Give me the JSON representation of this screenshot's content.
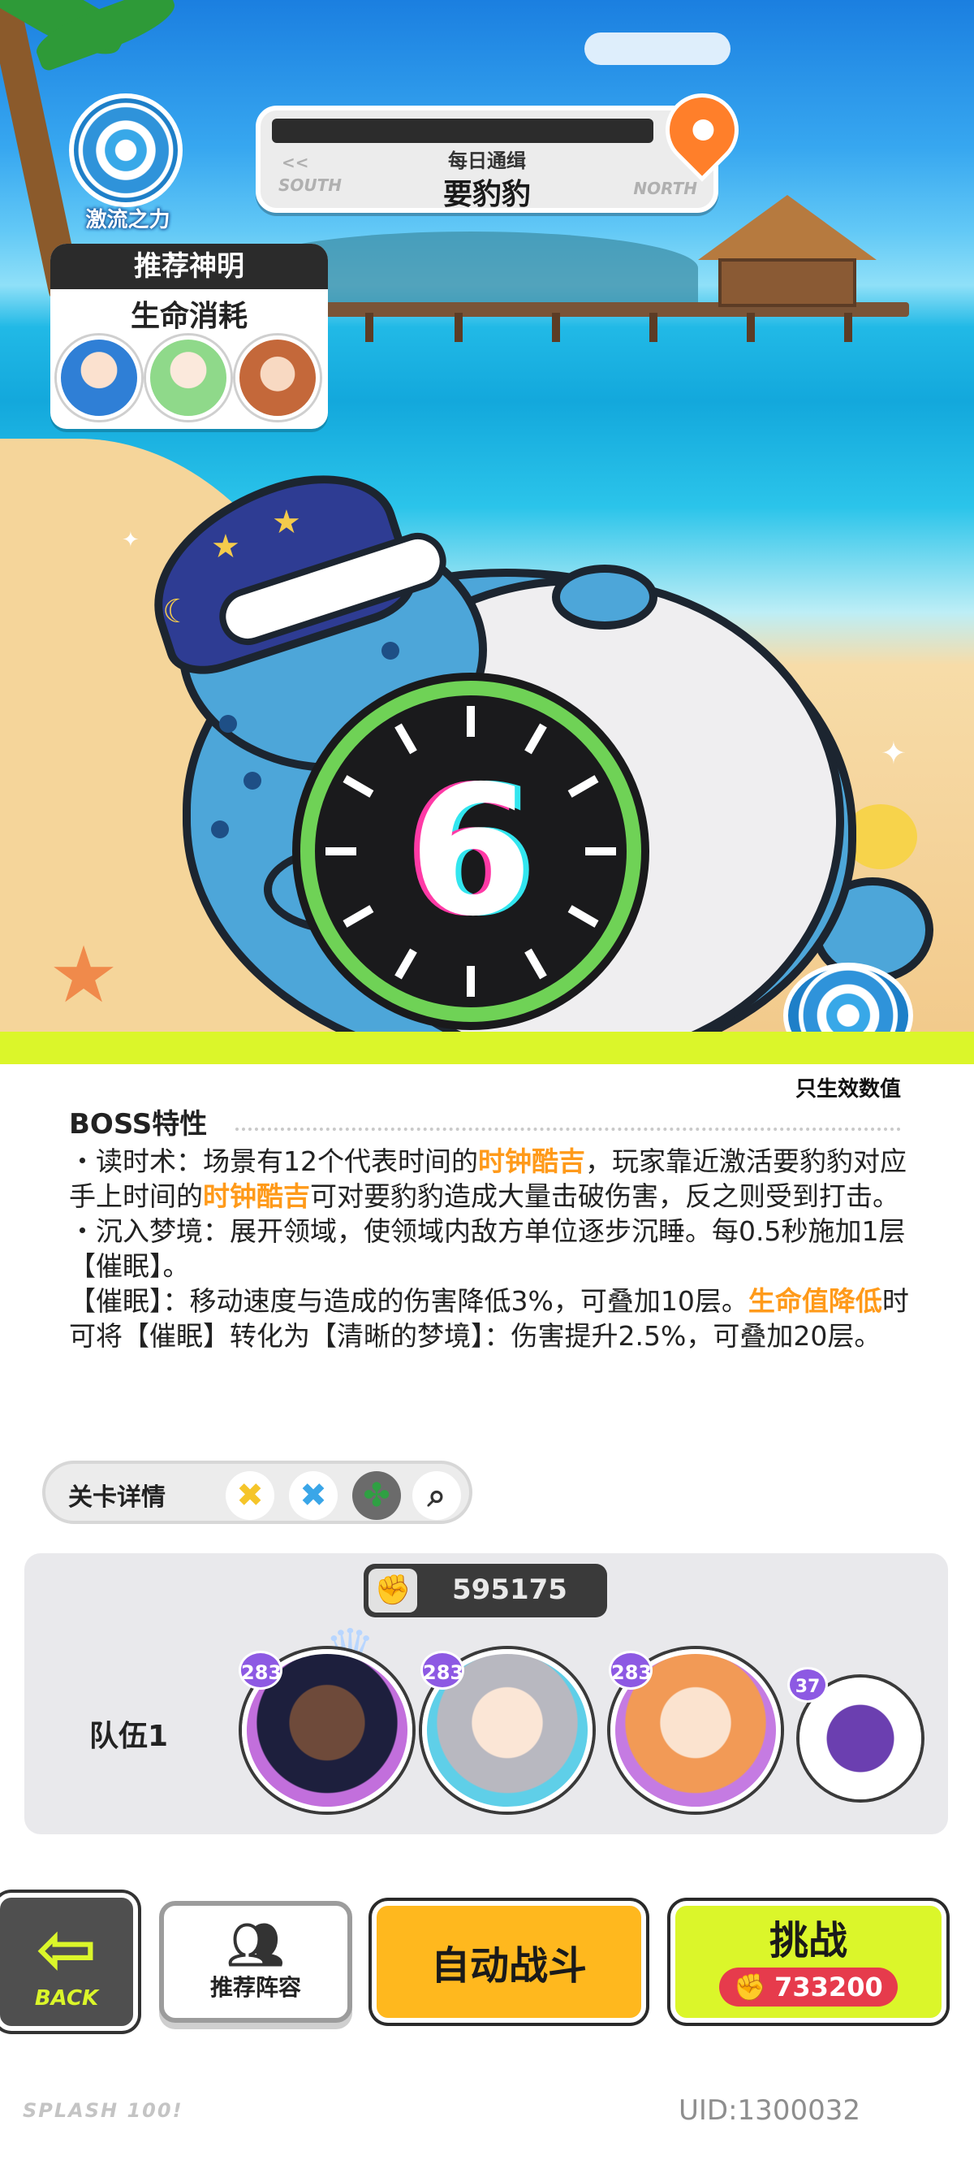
{
  "element": {
    "name": "激流之力",
    "icon": "water-swirl-icon",
    "note": "只生效数值"
  },
  "stage": {
    "subtitle": "每日通缉",
    "boss_name": "要豹豹",
    "left_direction": "SOUTH",
    "right_direction": "NORTH",
    "left_arrows": "<<"
  },
  "recommend": {
    "header": "推荐神明",
    "type": "生命消耗",
    "avatars": [
      "blue-hair-girl",
      "green-hair-girl",
      "brown-hair-boy"
    ]
  },
  "boss_clock": {
    "number": "6"
  },
  "boss_traits": {
    "title": "BOSS特性",
    "lines": [
      [
        "・读时术：场景有12个代表时间的",
        "时钟酷吉",
        "，玩家靠近激活要豹豹对应手上时间的",
        "时钟酷吉",
        "可对要豹豹造成大量击破伤害，反之则受到打击。"
      ],
      [
        "・沉入梦境：展开领域，使领域内敌方单位逐步沉睡。每0.5秒施加1层【催眠】。"
      ],
      [
        "【催眠】：移动速度与造成的伤害降低3%，可叠加10层。",
        "生命值降低",
        "时可将【催眠】转化为【清晰的梦境】：伤害提升2.5%，可叠加20层。"
      ]
    ]
  },
  "stage_details": {
    "label": "关卡详情",
    "icons": [
      "yellow-x-icon",
      "blue-x-icon",
      "green-clover-icon",
      "magnifier-icon"
    ]
  },
  "team": {
    "power": "595175",
    "label": "队伍1",
    "members": [
      {
        "name": "dark-hair-hero",
        "level": "283"
      },
      {
        "name": "silver-hair-hero",
        "level": "283"
      },
      {
        "name": "blonde-hero",
        "level": "283"
      },
      {
        "name": "grape-pet",
        "level": "37"
      }
    ]
  },
  "buttons": {
    "back": "BACK",
    "recommend_lineup": "推荐阵容",
    "auto_battle": "自动战斗",
    "challenge": "挑战",
    "challenge_cost": "733200"
  },
  "footer": {
    "logo": "SPLASH 100!",
    "uid": "UID:1300032"
  },
  "colors": {
    "accent_lime": "#dbf62a",
    "highlight_orange": "#ff9a1a",
    "auto_yellow": "#ffb81e",
    "cost_red": "#e63b4c"
  }
}
